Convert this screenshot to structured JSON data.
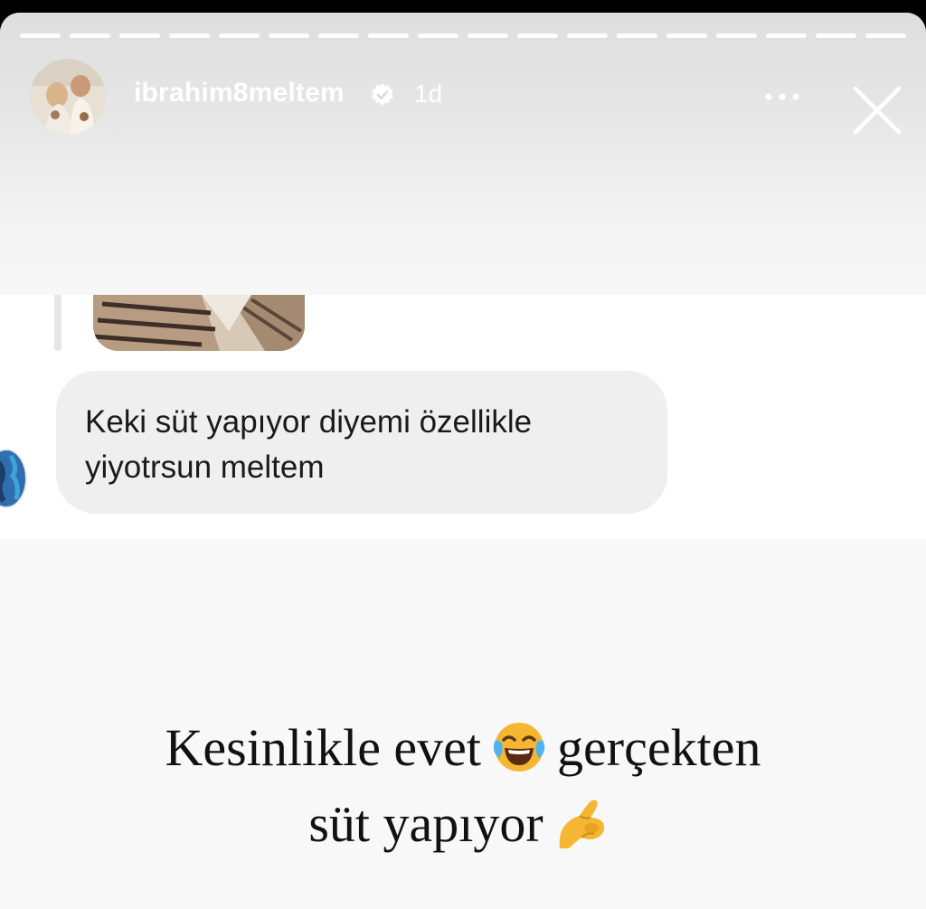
{
  "story": {
    "username": "ibrahim8meltem",
    "time_ago": "1d",
    "segment_count": 18,
    "icons": {
      "verified": "verified-badge-icon",
      "more": "more-horizontal-icon",
      "close": "close-icon"
    }
  },
  "chat": {
    "message_line1": "Keki süt yapıyor diyemi özellikle",
    "message_line2": "yiyotrsun meltem"
  },
  "caption": {
    "line1_before": "Kesinlikle evet",
    "line1_after": "gerçekten",
    "line2": "süt yapıyor",
    "emoji1": "face-with-tears-of-joy-icon",
    "emoji2": "pinching-hand-icon"
  },
  "colors": {
    "header_bg": "#e3e3e3",
    "bubble_bg": "#efefef",
    "caption_bg": "#f8f8f8",
    "emoji_yellow": "#f5b731"
  }
}
